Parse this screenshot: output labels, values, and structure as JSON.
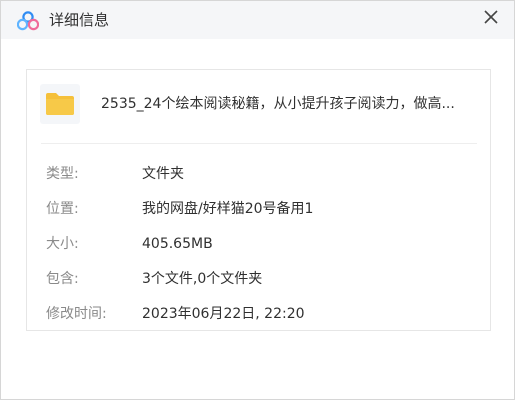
{
  "dialog": {
    "title": "详细信息",
    "close_icon": "close-icon",
    "logo_icon": "baidu-netdisk-logo"
  },
  "file": {
    "icon": "folder-icon",
    "icon_color": "#f5c03a",
    "name": "2535_24个绘本阅读秘籍，从小提升孩子阅读力，做高..."
  },
  "details": [
    {
      "label": "类型:",
      "value": "文件夹"
    },
    {
      "label": "位置:",
      "value": "我的网盘/好样猫20号备用1"
    },
    {
      "label": "大小:",
      "value": "405.65MB"
    },
    {
      "label": "包含:",
      "value": "3个文件,0个文件夹"
    },
    {
      "label": "修改时间:",
      "value": "2023年06月22日, 22:20"
    }
  ]
}
